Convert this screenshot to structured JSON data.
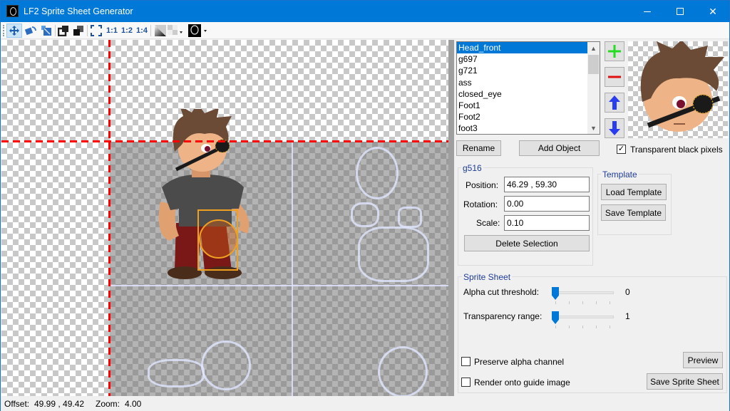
{
  "window": {
    "title": "LF2 Sprite Sheet Generator",
    "controls": [
      "minimize",
      "maximize",
      "close"
    ]
  },
  "toolbar": {
    "tools": [
      {
        "name": "move-tool",
        "icon": "move-arrows-icon",
        "active": true
      },
      {
        "name": "rotate-tool",
        "icon": "rotate-icon",
        "active": false
      },
      {
        "name": "scale-tool",
        "icon": "scale-icon",
        "active": false
      },
      {
        "name": "bring-forward",
        "icon": "bring-forward-icon",
        "active": false
      },
      {
        "name": "send-backward",
        "icon": "send-backward-icon",
        "active": false
      },
      {
        "name": "zoom-fit",
        "icon": "fit-frame-icon",
        "active": false
      }
    ],
    "zoom_1_1": "1:1",
    "zoom_1_2": "1:2",
    "zoom_1_4": "1:4",
    "background_dropdown": "gradient-checker-icon",
    "guide_dropdown": "guide-image-icon"
  },
  "object_list": {
    "items": [
      "Head_front",
      "g697",
      "g721",
      "ass",
      "closed_eye",
      "Foot1",
      "Foot2",
      "foot3"
    ],
    "selected": "Head_front"
  },
  "side_buttons": {
    "add": "+",
    "remove": "−",
    "up": "▲",
    "down": "▼"
  },
  "transparent_black": {
    "label": "Transparent black pixels",
    "checked": true
  },
  "buttons": {
    "rename": "Rename",
    "add_object": "Add Object",
    "delete_selection": "Delete Selection",
    "load_template": "Load Template",
    "save_template": "Save Template",
    "preview": "Preview",
    "save_sprite_sheet": "Save Sprite Sheet"
  },
  "selection": {
    "group_title": "g516",
    "position_label": "Position:",
    "position_value": "46.29 , 59.30",
    "rotation_label": "Rotation:",
    "rotation_value": "0.00",
    "scale_label": "Scale:",
    "scale_value": "0.10"
  },
  "template": {
    "group_title": "Template"
  },
  "sprite_sheet": {
    "group_title": "Sprite Sheet",
    "alpha_cut_label": "Alpha cut threshold:",
    "alpha_cut_value": "0",
    "transparency_label": "Transparency range:",
    "transparency_value": "1",
    "preserve_alpha_label": "Preserve alpha channel",
    "preserve_alpha_checked": false,
    "render_guide_label": "Render onto guide image",
    "render_guide_checked": false
  },
  "status": {
    "offset_label": "Offset:",
    "offset_value": "49.99 , 49.42",
    "zoom_label": "Zoom:",
    "zoom_value": "4.00"
  },
  "colors": {
    "titlebar": "#0078d7",
    "selection_highlight": "#0078d7",
    "guide_red": "#ff0000",
    "selection_box": "#f0a020",
    "group_title": "#1e3c96"
  }
}
